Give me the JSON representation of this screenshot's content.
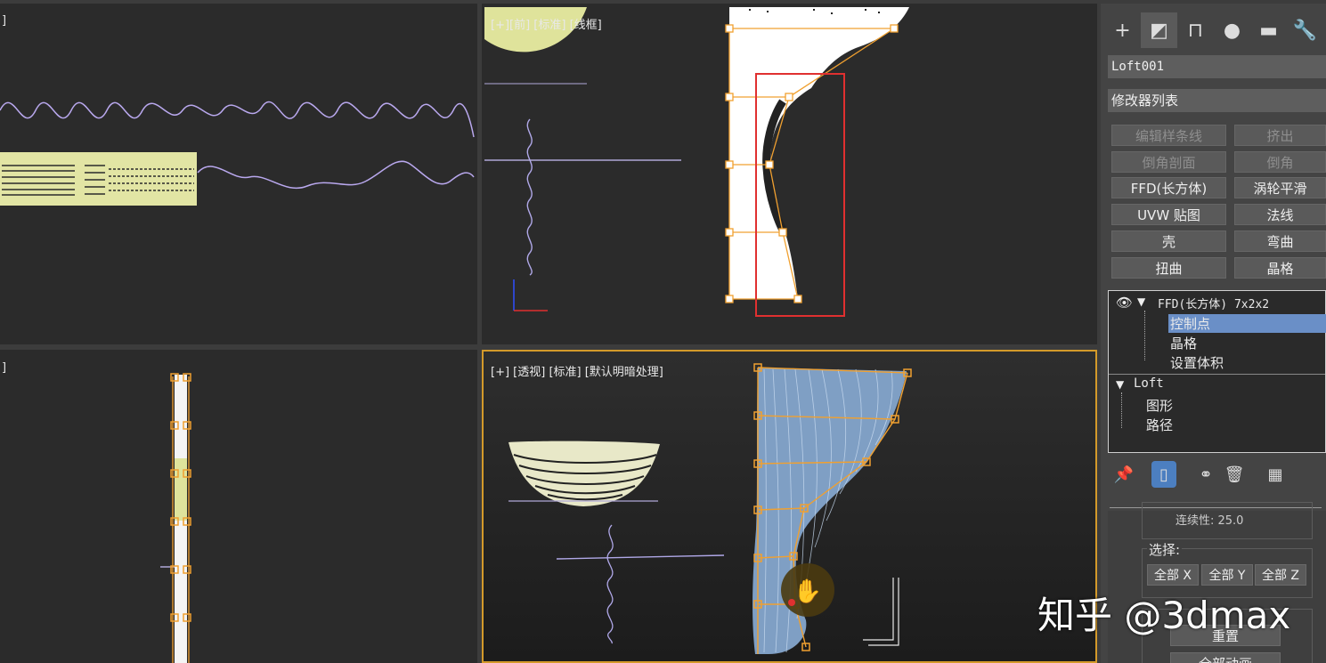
{
  "viewports": {
    "top_left_label": "]",
    "front_label": "[+][前] [标准] [线框]",
    "bottom_left_label": "]",
    "perspective_label": "[+] [透视] [标准] [默认明暗处理]"
  },
  "command_panel": {
    "tabs": [
      {
        "icon": "create-plus-icon",
        "glyph": "+"
      },
      {
        "icon": "modify-icon",
        "glyph": "◩"
      },
      {
        "icon": "hierarchy-icon",
        "glyph": "⊓"
      },
      {
        "icon": "motion-icon",
        "glyph": "●"
      },
      {
        "icon": "display-icon",
        "glyph": "▬"
      },
      {
        "icon": "utilities-wrench-icon",
        "glyph": "🔧"
      }
    ],
    "object_name": "Loft001",
    "modifier_list": "修改器列表",
    "modifier_buttons": [
      {
        "label": "编辑样条线",
        "enabled": false
      },
      {
        "label": "挤出",
        "enabled": false
      },
      {
        "label": "倒角剖面",
        "enabled": false
      },
      {
        "label": "倒角",
        "enabled": false
      },
      {
        "label": "FFD(长方体)",
        "enabled": true
      },
      {
        "label": "涡轮平滑",
        "enabled": true
      },
      {
        "label": "UVW 贴图",
        "enabled": true
      },
      {
        "label": "法线",
        "enabled": true
      },
      {
        "label": "壳",
        "enabled": true
      },
      {
        "label": "弯曲",
        "enabled": true
      },
      {
        "label": "扭曲",
        "enabled": true
      },
      {
        "label": "晶格",
        "enabled": true
      }
    ],
    "stack": {
      "ffd": "FFD(长方体) 7x2x2",
      "control_points": "控制点",
      "lattice": "晶格",
      "set_volume": "设置体积",
      "loft": "Loft",
      "shape": "图形",
      "path": "路径"
    },
    "tension_partial": "连续性: 25.0",
    "select_group": {
      "title": "选择:",
      "all_x": "全部 X",
      "all_y": "全部 Y",
      "all_z": "全部 Z"
    },
    "reset_label": "重置",
    "animate_all_partial": "全部动画"
  },
  "watermark": "知乎 @3dmax",
  "colors": {
    "accent_selection": "#6a8fc7",
    "active_viewport_border": "#d49a2a",
    "control_point_orange": "#f0a030",
    "highlight_box_red": "#e03030"
  }
}
